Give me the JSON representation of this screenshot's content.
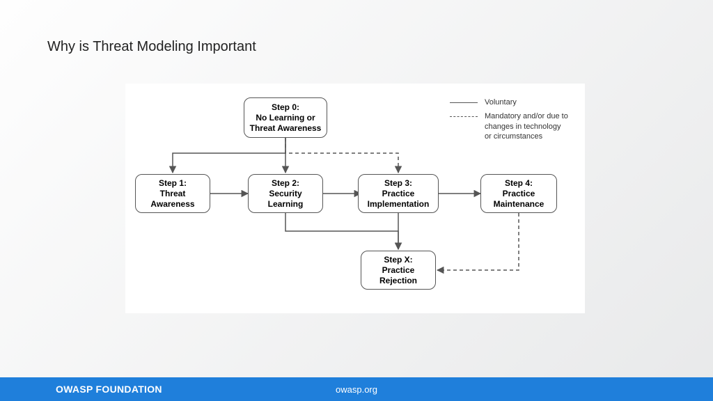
{
  "slide": {
    "title": "Why is Threat Modeling Important"
  },
  "footer": {
    "org": "OWASP FOUNDATION",
    "url": "owasp.org"
  },
  "legend": {
    "voluntary": "Voluntary",
    "mandatory": "Mandatory and/or due to changes in technology or circumstances"
  },
  "nodes": {
    "step0": "Step 0:\nNo Learning or\nThreat Awareness",
    "step1": "Step 1:\nThreat\nAwareness",
    "step2": "Step 2:\nSecurity\nLearning",
    "step3": "Step 3:\nPractice\nImplementation",
    "step4": "Step 4:\nPractice\nMaintenance",
    "stepx": "Step X:\nPractice\nRejection"
  },
  "diagram": {
    "edges": [
      {
        "from": "step0",
        "to": "step1",
        "style": "solid",
        "note": "down-left elbow"
      },
      {
        "from": "step0",
        "to": "step2",
        "style": "solid",
        "note": "straight down"
      },
      {
        "from": "step0",
        "to": "step3",
        "style": "dashed",
        "note": "down-right elbow"
      },
      {
        "from": "step1",
        "to": "step2",
        "style": "solid"
      },
      {
        "from": "step2",
        "to": "step3",
        "style": "solid"
      },
      {
        "from": "step3",
        "to": "step4",
        "style": "solid"
      },
      {
        "from": "step2",
        "to": "stepx",
        "style": "solid",
        "note": "down-right elbow into top of stepx"
      },
      {
        "from": "step3",
        "to": "stepx",
        "style": "solid",
        "note": "straight down"
      },
      {
        "from": "step4",
        "to": "stepx",
        "style": "dashed",
        "note": "down-left elbow into right of stepx"
      }
    ]
  }
}
